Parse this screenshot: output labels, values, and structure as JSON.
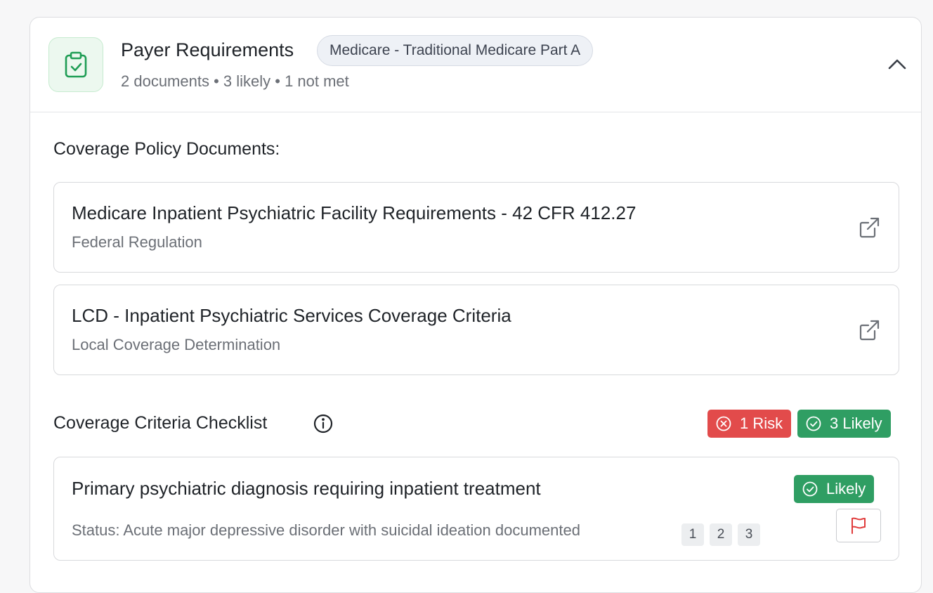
{
  "header": {
    "title": "Payer Requirements",
    "payer_badge": "Medicare - Traditional Medicare Part A",
    "summary": "2 documents • 3 likely • 1 not met"
  },
  "policy_section": {
    "title": "Coverage Policy Documents:",
    "documents": [
      {
        "title": "Medicare Inpatient Psychiatric Facility Requirements - 42 CFR 412.27",
        "type": "Federal Regulation"
      },
      {
        "title": "LCD - Inpatient Psychiatric Services Coverage Criteria",
        "type": "Local Coverage Determination"
      }
    ]
  },
  "checklist": {
    "title": "Coverage Criteria Checklist",
    "risk_label": "1 Risk",
    "likely_label": "3 Likely",
    "items": [
      {
        "title": "Primary psychiatric diagnosis requiring inpatient treatment",
        "status": "Status: Acute major depressive disorder with suicidal ideation documented",
        "badge": "Likely",
        "citations": [
          "1",
          "2",
          "3"
        ]
      }
    ]
  },
  "colors": {
    "risk": "#e24b4b",
    "likely": "#2f9e63",
    "icon_accent": "#1f9d55",
    "flag": "#e03b3b"
  }
}
